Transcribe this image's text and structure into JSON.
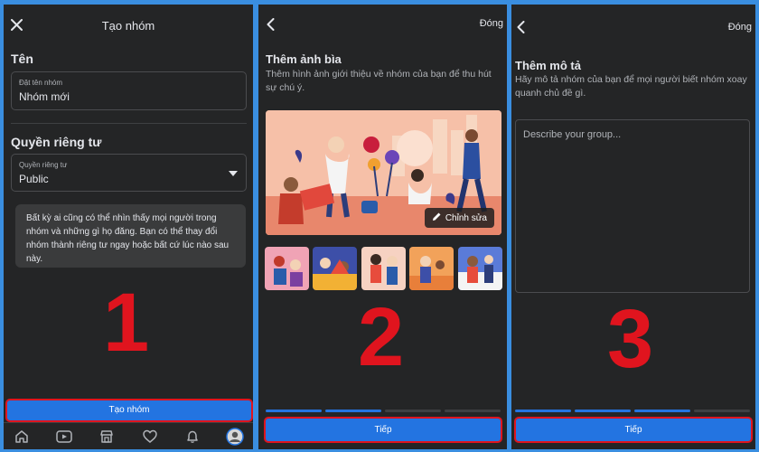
{
  "panel1": {
    "header_title": "Tạo nhóm",
    "name_section": "Tên",
    "name_field_label": "Đặt tên nhóm",
    "name_field_value": "Nhóm mới",
    "privacy_section": "Quyền riêng tư",
    "privacy_field_label": "Quyền riêng tư",
    "privacy_field_value": "Public",
    "info_text": "Bất kỳ ai cũng có thể nhìn thấy mọi người trong nhóm và những gì họ đăng. Bạn có thể thay đổi nhóm thành riêng tư ngay hoặc bất cứ lúc nào sau này.",
    "create_button": "Tạo nhóm",
    "step_number": "1"
  },
  "panel2": {
    "close_label": "Đóng",
    "title": "Thêm ảnh bìa",
    "description": "Thêm hình ảnh giới thiệu về nhóm của bạn để thu hút sự chú ý.",
    "edit_label": "Chỉnh sửa",
    "next_button": "Tiếp",
    "step_number": "2"
  },
  "panel3": {
    "close_label": "Đóng",
    "title": "Thêm mô tả",
    "description": "Hãy mô tả nhóm của bạn để mọi người biết nhóm xoay quanh chủ đề gì.",
    "placeholder": "Describe your group...",
    "next_button": "Tiếp",
    "step_number": "3"
  },
  "colors": {
    "accent": "#2374e1",
    "highlight": "#e0141e",
    "background": "#242526",
    "frame": "#3a8ee0"
  },
  "icons": [
    "close-icon",
    "back-icon",
    "dropdown-arrow-icon",
    "pencil-icon",
    "home-icon",
    "video-icon",
    "marketplace-icon",
    "dating-icon",
    "bell-icon",
    "avatar"
  ]
}
